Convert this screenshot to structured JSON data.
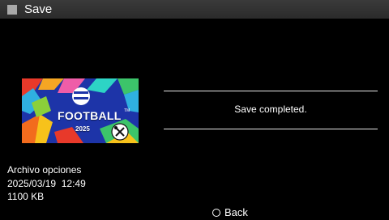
{
  "header": {
    "title": "Save",
    "icon": "square-icon"
  },
  "thumbnail": {
    "logo_text": "FOOTBALL",
    "year_text": "2025",
    "tm_text": "TM",
    "badge_icon": "tools-icon"
  },
  "dialog": {
    "message": "Save completed."
  },
  "save_info": {
    "name": "Archivo opciones",
    "datetime": "2025/03/19  12:49",
    "size": "1100 KB"
  },
  "footer": {
    "back_label": "Back",
    "back_icon": "circle-button-icon"
  },
  "colors": {
    "background": "#000000",
    "title_bar": "#2f2f2f",
    "title_icon": "#a9a9a9",
    "text": "#ffffff"
  }
}
